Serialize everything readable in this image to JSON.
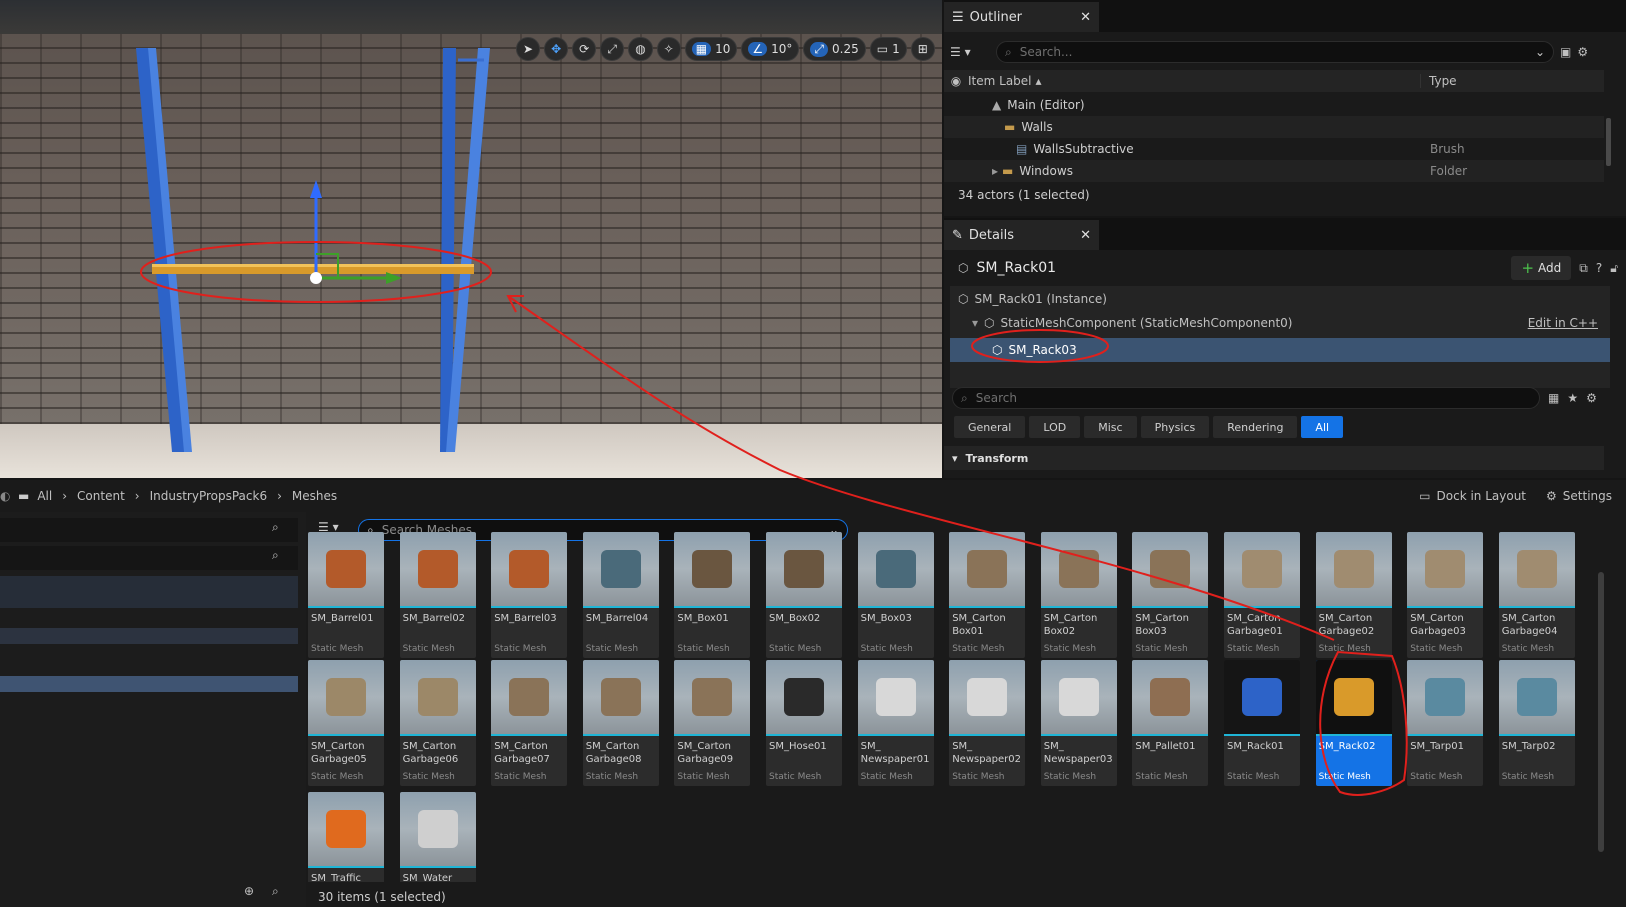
{
  "viewport": {
    "toolbar": {
      "grid_snap": "10",
      "angle_snap": "10°",
      "scale_snap": "0.25",
      "camera_speed": "1"
    }
  },
  "outliner": {
    "tab_label": "Outliner",
    "search_placeholder": "Search...",
    "col_item_label": "Item Label",
    "col_type": "Type",
    "rows": [
      {
        "label": "Main (Editor)",
        "type": ""
      },
      {
        "label": "Walls",
        "type": ""
      },
      {
        "label": "WallsSubtractive",
        "type": "Brush"
      },
      {
        "label": "Windows",
        "type": "Folder"
      }
    ],
    "status": "34 actors (1 selected)"
  },
  "details": {
    "tab_label": "Details",
    "object_name": "SM_Rack01",
    "add_label": "Add",
    "components": {
      "instance": "SM_Rack01 (Instance)",
      "mesh_component": "StaticMeshComponent (StaticMeshComponent0)",
      "edit_link": "Edit in C++",
      "selected": "SM_Rack03"
    },
    "search_placeholder": "Search",
    "filters": [
      "General",
      "LOD",
      "Misc",
      "Physics",
      "Rendering",
      "All"
    ],
    "active_filter": "All",
    "section": "Transform"
  },
  "content_browser": {
    "breadcrumb": [
      "All",
      "Content",
      "IndustryPropsPack6",
      "Meshes"
    ],
    "dock_label": "Dock in Layout",
    "settings_label": "Settings",
    "search_placeholder": "Search Meshes",
    "assets": [
      {
        "name": "SM_Barrel01",
        "type": "Static Mesh"
      },
      {
        "name": "SM_Barrel02",
        "type": "Static Mesh"
      },
      {
        "name": "SM_Barrel03",
        "type": "Static Mesh"
      },
      {
        "name": "SM_Barrel04",
        "type": "Static Mesh"
      },
      {
        "name": "SM_Box01",
        "type": "Static Mesh"
      },
      {
        "name": "SM_Box02",
        "type": "Static Mesh"
      },
      {
        "name": "SM_Box03",
        "type": "Static Mesh"
      },
      {
        "name": "SM_Carton Box01",
        "type": "Static Mesh"
      },
      {
        "name": "SM_Carton Box02",
        "type": "Static Mesh"
      },
      {
        "name": "SM_Carton Box03",
        "type": "Static Mesh"
      },
      {
        "name": "SM_Carton Garbage01",
        "type": "Static Mesh"
      },
      {
        "name": "SM_Carton Garbage02",
        "type": "Static Mesh"
      },
      {
        "name": "SM_Carton Garbage03",
        "type": "Static Mesh"
      },
      {
        "name": "SM_Carton Garbage04",
        "type": "Static Mesh"
      },
      {
        "name": "SM_Carton Garbage05",
        "type": "Static Mesh"
      },
      {
        "name": "SM_Carton Garbage06",
        "type": "Static Mesh"
      },
      {
        "name": "SM_Carton Garbage07",
        "type": "Static Mesh"
      },
      {
        "name": "SM_Carton Garbage08",
        "type": "Static Mesh"
      },
      {
        "name": "SM_Carton Garbage09",
        "type": "Static Mesh"
      },
      {
        "name": "SM_Hose01",
        "type": "Static Mesh"
      },
      {
        "name": "SM_ Newspaper01",
        "type": "Static Mesh"
      },
      {
        "name": "SM_ Newspaper02",
        "type": "Static Mesh"
      },
      {
        "name": "SM_ Newspaper03",
        "type": "Static Mesh"
      },
      {
        "name": "SM_Pallet01",
        "type": "Static Mesh"
      },
      {
        "name": "SM_Rack01",
        "type": "Static Mesh"
      },
      {
        "name": "SM_Rack02",
        "type": "Static Mesh"
      },
      {
        "name": "SM_Tarp01",
        "type": "Static Mesh"
      },
      {
        "name": "SM_Tarp02",
        "type": "Static Mesh"
      },
      {
        "name": "SM_Traffic",
        "type": ""
      },
      {
        "name": "SM_Water",
        "type": ""
      }
    ],
    "selected_asset": "SM_Rack02",
    "status": "30 items (1 selected)"
  },
  "colors": {
    "accent": "#1473e6",
    "annotation": "#e0201c",
    "asset_bar": "#1fb5d6"
  }
}
